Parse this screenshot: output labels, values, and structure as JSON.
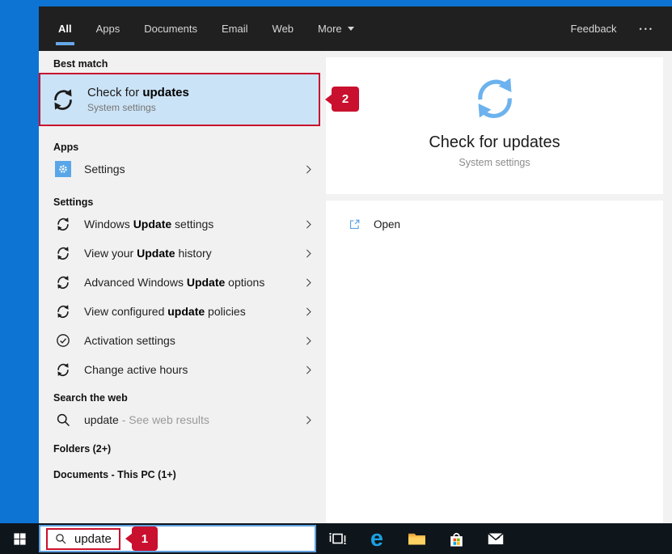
{
  "header": {
    "tabs": [
      {
        "label": "All"
      },
      {
        "label": "Apps"
      },
      {
        "label": "Documents"
      },
      {
        "label": "Email"
      },
      {
        "label": "Web"
      },
      {
        "label": "More"
      }
    ],
    "feedback": "Feedback",
    "more_menu": "•••"
  },
  "left": {
    "best_match_header": "Best match",
    "best_match": {
      "title_pre": "Check for ",
      "title_bold": "updates",
      "subtitle": "System settings"
    },
    "apps_header": "Apps",
    "apps_item": {
      "label": "Settings"
    },
    "settings_header": "Settings",
    "settings_items": [
      {
        "pre": "Windows ",
        "bold": "Update",
        "post": " settings",
        "icon": "refresh-icon"
      },
      {
        "pre": "View your ",
        "bold": "Update",
        "post": " history",
        "icon": "refresh-icon"
      },
      {
        "pre": "Advanced Windows ",
        "bold": "Update",
        "post": " options",
        "icon": "refresh-icon"
      },
      {
        "pre": "View configured ",
        "bold": "update",
        "post": " policies",
        "icon": "refresh-icon"
      },
      {
        "pre": "Activation settings",
        "bold": "",
        "post": "",
        "icon": "checkmark-circle-icon"
      },
      {
        "pre": "Change active hours",
        "bold": "",
        "post": "",
        "icon": "refresh-icon"
      }
    ],
    "web_header": "Search the web",
    "web_item": {
      "query": "update",
      "hint": " - See web results"
    },
    "folders_header": "Folders (2+)",
    "documents_header": "Documents - This PC (1+)"
  },
  "preview": {
    "title": "Check for updates",
    "subtitle": "System settings",
    "open_label": "Open"
  },
  "annotations": {
    "callout1": "1",
    "callout2": "2"
  },
  "taskbar": {
    "search_value": "update"
  },
  "colors": {
    "accent_blue": "#66a8e8",
    "highlight_blue": "#cbe3f6",
    "annotation_red": "#c9102e",
    "icon_blue": "#6cb2ee",
    "desktop_blue": "#0d74d4",
    "taskbar_dark": "#0e151b",
    "header_dark": "#202020"
  }
}
